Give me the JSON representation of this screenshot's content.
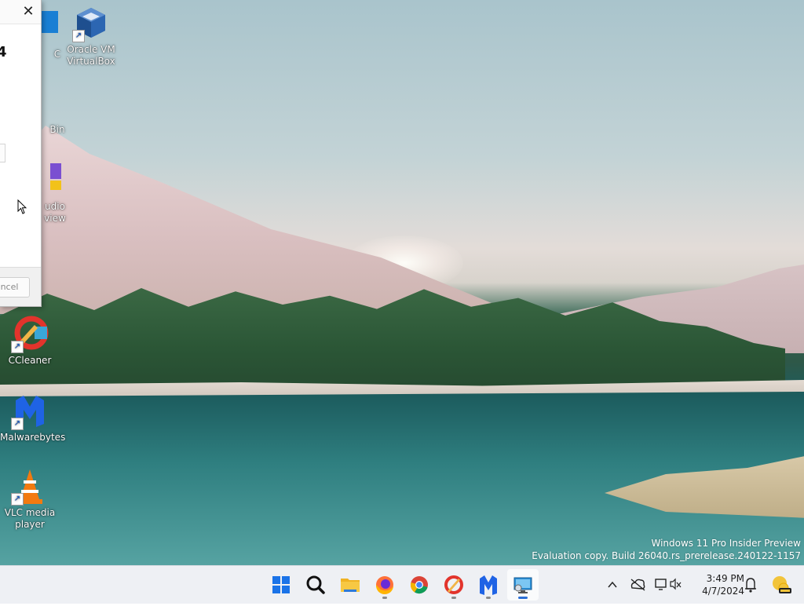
{
  "desktop": {
    "watermark": {
      "line1": "Windows 11 Pro Insider Preview",
      "line2": "Evaluation copy. Build 26040.rs_prerelease.240122-1157"
    },
    "icons": [
      {
        "id": "partial-top",
        "label": "C"
      },
      {
        "id": "virtualbox",
        "label": "Oracle VM VirtualBox"
      },
      {
        "id": "recycle-bin",
        "label": "Bin"
      },
      {
        "id": "audio",
        "label": "udio view"
      },
      {
        "id": "ccleaner",
        "label": "CCleaner"
      },
      {
        "id": "malwarebytes",
        "label": "Malwarebytes"
      },
      {
        "id": "vlc",
        "label": "VLC media player"
      }
    ]
  },
  "dialog": {
    "close_glyph": "✕",
    "heading_fragment": "4",
    "cancel_label": "ncel"
  },
  "taskbar": {
    "apps": [
      {
        "name": "Start"
      },
      {
        "name": "Search"
      },
      {
        "name": "File Explorer"
      },
      {
        "name": "Firefox"
      },
      {
        "name": "Chrome"
      },
      {
        "name": "CCleaner"
      },
      {
        "name": "Malwarebytes"
      },
      {
        "name": "Remote Desktop"
      }
    ],
    "tray": {
      "chevron": "^",
      "time": "3:49 PM",
      "date": "4/7/2024"
    }
  }
}
